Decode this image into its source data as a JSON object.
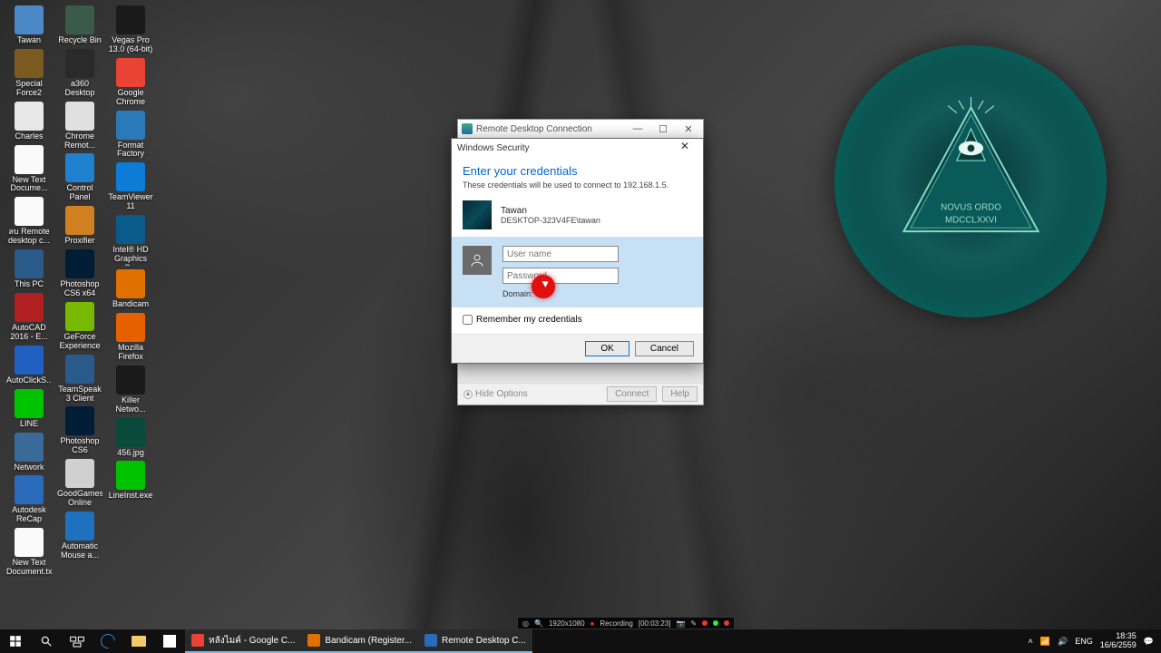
{
  "desktop_icons": [
    {
      "label": "Tawan",
      "bg": "#4a88c7"
    },
    {
      "label": "Special Force2",
      "bg": "#7a5a20"
    },
    {
      "label": "Charles",
      "bg": "#e8e8e8"
    },
    {
      "label": "New Text Docume...",
      "bg": "#fafafa"
    },
    {
      "label": "ลบ Remote desktop c...",
      "bg": "#fafafa"
    },
    {
      "label": "This PC",
      "bg": "#2a5a8a"
    },
    {
      "label": "AutoCAD 2016 - E...",
      "bg": "#b02020"
    },
    {
      "label": "AutoClickS...",
      "bg": "#2060c0"
    },
    {
      "label": "LINE",
      "bg": "#00c300"
    },
    {
      "label": "Network",
      "bg": "#3a6a9a"
    },
    {
      "label": "Autodesk ReCap",
      "bg": "#2a6aba"
    },
    {
      "label": "New Text Document.txt",
      "bg": "#fafafa"
    },
    {
      "label": "Recycle Bin",
      "bg": "#3a5a4a"
    },
    {
      "label": "a360 Desktop",
      "bg": "#2a2a2a"
    },
    {
      "label": "Chrome Remot...",
      "bg": "#e0e0e0"
    },
    {
      "label": "Control Panel",
      "bg": "#2080d0"
    },
    {
      "label": "Proxifier",
      "bg": "#d08020"
    },
    {
      "label": "Photoshop CS6 x64",
      "bg": "#001d36"
    },
    {
      "label": "GeForce Experience",
      "bg": "#76b900"
    },
    {
      "label": "TeamSpeak 3 Client",
      "bg": "#2a5a8a"
    },
    {
      "label": "Photoshop CS6",
      "bg": "#001d36"
    },
    {
      "label": "GoodGames Online",
      "bg": "#d0d0d0"
    },
    {
      "label": "Automatic Mouse a...",
      "bg": "#2070c0"
    },
    {
      "label": "Vegas Pro 13.0 (64-bit)",
      "bg": "#1a1a1a"
    },
    {
      "label": "Google Chrome",
      "bg": "#ea4335"
    },
    {
      "label": "Format Factory",
      "bg": "#2a7aba"
    },
    {
      "label": "TeamViewer 11",
      "bg": "#0d7cd6"
    },
    {
      "label": "Intel® HD Graphics C...",
      "bg": "#0a5a8a"
    },
    {
      "label": "Bandicam",
      "bg": "#e07000"
    },
    {
      "label": "Mozilla Firefox",
      "bg": "#e66000"
    },
    {
      "label": "Killer Netwo...",
      "bg": "#1a1a1a"
    },
    {
      "label": "456.jpg",
      "bg": "#0a4a3a"
    },
    {
      "label": "LineInst.exe",
      "bg": "#00c300"
    }
  ],
  "rdc": {
    "title": "Remote Desktop Connection",
    "hide": "Hide Options",
    "connect": "Connect",
    "help": "Help"
  },
  "sec": {
    "title": "Windows Security",
    "heading": "Enter your credentials",
    "sub": "These credentials will be used to connect to 192.168.1.5.",
    "user_display": "Tawan",
    "user_domain": "DESKTOP-323V4FE\\tawan",
    "ph_user": "User name",
    "ph_pass": "Password",
    "domain_label": "Domain:",
    "remember": "Remember my credentials",
    "ok": "OK",
    "cancel": "Cancel"
  },
  "bandicam": {
    "res": "1920x1080",
    "status": "Recording",
    "time": "[00:03:23]"
  },
  "taskbar": {
    "tasks": [
      {
        "label": "หลังไมค์ - Google C...",
        "bg": "#ea4335"
      },
      {
        "label": "Bandicam (Register...",
        "bg": "#e07000"
      },
      {
        "label": "Remote Desktop C...",
        "bg": "#2a6aba"
      }
    ],
    "lang": "ENG",
    "time": "18:35",
    "date": "16/6/2559"
  }
}
